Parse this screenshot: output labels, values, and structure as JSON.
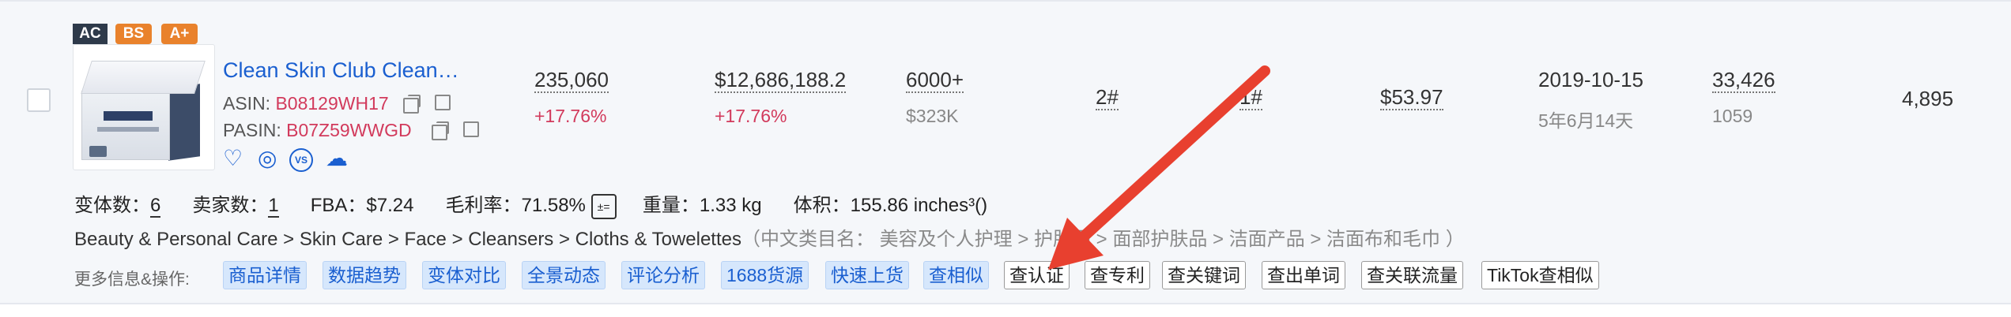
{
  "badges": {
    "ac": "AC",
    "bs": "BS",
    "aplus": "A+"
  },
  "product": {
    "title": "Clean Skin Club Clean…",
    "asin_label": "ASIN:",
    "asin": "B08129WH17",
    "pasin_label": "PASIN:",
    "pasin": "B07Z59WWGD"
  },
  "metrics": {
    "sales": "235,060",
    "sales_change": "+17.76%",
    "revenue": "$12,686,188.2",
    "revenue_change": "+17.76%",
    "reviews": "6000+",
    "reviews_value": "$323K",
    "rank_main": "2#",
    "rank_sub": "1#",
    "price": "$53.97",
    "launch_date": "2019-10-15",
    "launch_age": "5年6月14天",
    "ratings": "33,426",
    "ratings_sub": "1059",
    "last_value": "4,895"
  },
  "details": {
    "variants_label": "变体数：",
    "variants": "6",
    "sellers_label": "卖家数：",
    "sellers": "1",
    "fba": "FBA：$7.24",
    "margin": "毛利率：71.58%",
    "weight": "重量：1.33 kg",
    "volume": "体积：155.86 inches³()"
  },
  "category": {
    "path": "Beauty & Personal Care > Skin Care > Face > Cleansers > Cloths & Towelettes",
    "cn": "（中文类目名： 美容及个人护理 > 护肤品 > 面部护肤品 > 洁面产品 > 洁面布和毛巾 ）"
  },
  "actions": {
    "label": "更多信息&操作:",
    "blue_tags": [
      "商品详情",
      "数据趋势",
      "变体对比",
      "全景动态",
      "评论分析",
      "1688货源",
      "快速上货",
      "查相似"
    ],
    "plain_tags": [
      "查认证",
      "查专利",
      "查关键词",
      "查出单词",
      "查关联流量",
      "TikTok查相似"
    ]
  },
  "colors": {
    "accent_blue": "#1a5fd0",
    "accent_red": "#d23a5c",
    "badge_orange": "#e9822c",
    "arrow_red": "#e8402f"
  }
}
